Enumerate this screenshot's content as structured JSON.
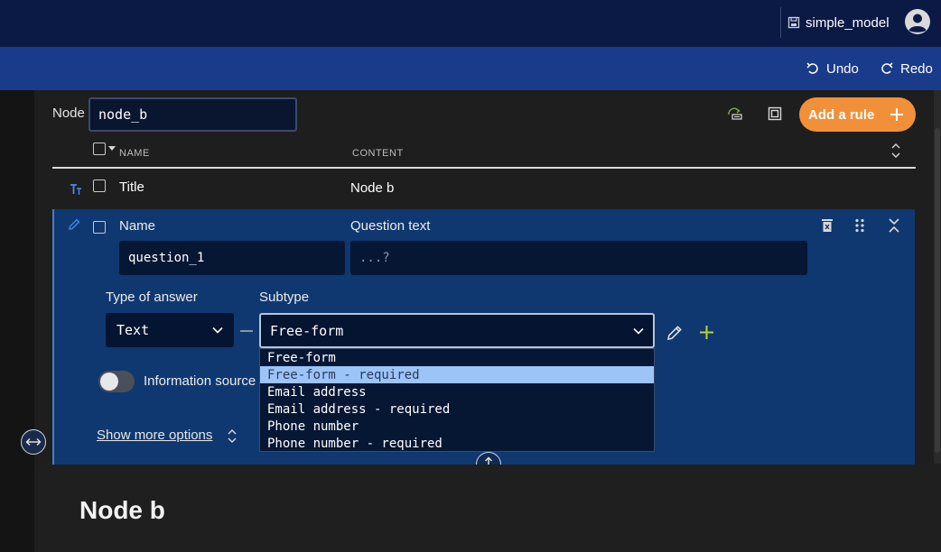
{
  "header": {
    "model_name": "simple_model"
  },
  "toolbar": {
    "undo_label": "Undo",
    "redo_label": "Redo"
  },
  "node": {
    "label": "Node",
    "value": "node_b"
  },
  "actions": {
    "add_rule_label": "Add a rule"
  },
  "table": {
    "columns": [
      "NAME",
      "CONTENT"
    ],
    "title_row": {
      "name": "Title",
      "content": "Node b"
    }
  },
  "question": {
    "name_label": "Name",
    "name_value": "question_1",
    "text_label": "Question text",
    "text_placeholder": "...?",
    "type_label": "Type of answer",
    "type_value": "Text",
    "subtype_label": "Subtype",
    "subtype_value": "Free-form",
    "subtype_options": [
      "Free-form",
      "Free-form - required",
      "Email address",
      "Email address - required",
      "Phone number",
      "Phone number - required"
    ],
    "highlighted_option": 1,
    "info_source_label": "Information source",
    "show_more_label": "Show more options"
  },
  "preview": {
    "title": "Node b"
  },
  "colors": {
    "accent": "#f2903a",
    "header": "#0b1a45",
    "subbar": "#1a3a8a",
    "selected_row": "#0f3870",
    "add_icon": "#b6d33a"
  }
}
